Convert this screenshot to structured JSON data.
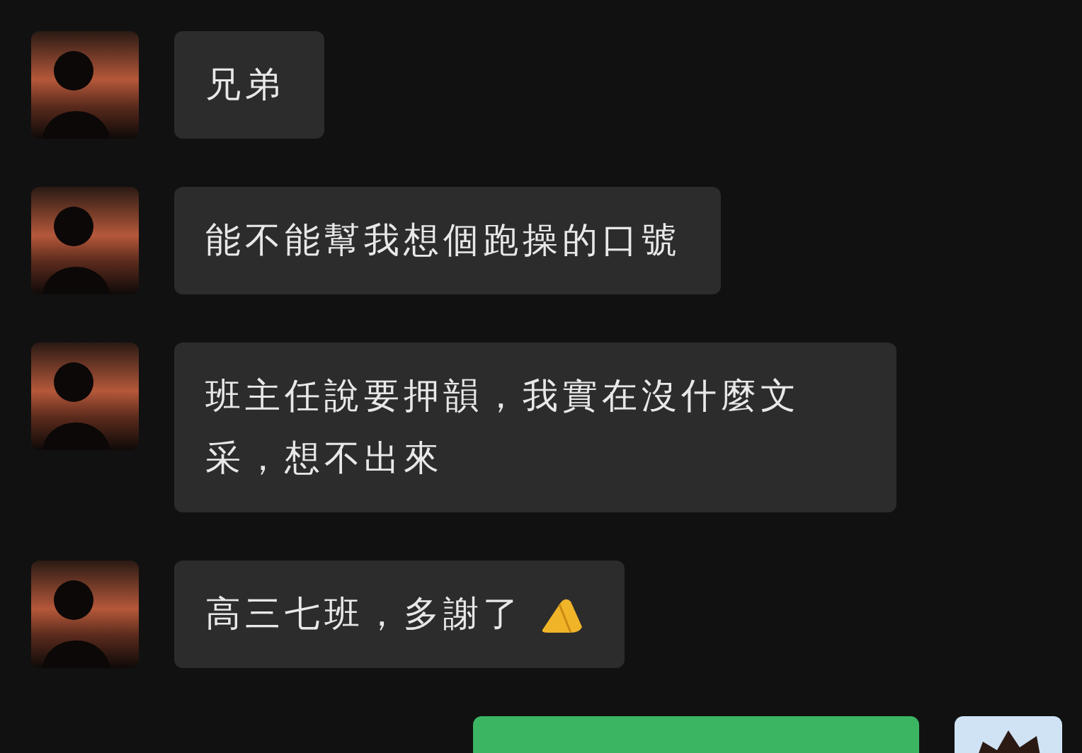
{
  "messages": [
    {
      "kind": "incoming",
      "text": "兄弟",
      "trailing_icon": false
    },
    {
      "kind": "incoming",
      "text": "能不能幫我想個跑操的口號",
      "trailing_icon": false
    },
    {
      "kind": "incoming",
      "text": "班主任說要押韻，我實在沒什麼文采，想不出來",
      "trailing_icon": false
    },
    {
      "kind": "incoming",
      "text": "高三七班，多謝了",
      "trailing_icon": true
    },
    {
      "kind": "outgoing"
    }
  ]
}
